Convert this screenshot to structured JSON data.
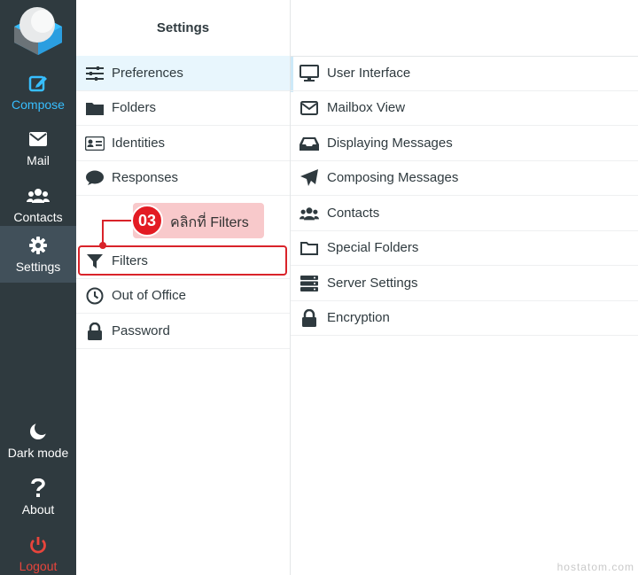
{
  "nav": {
    "compose": "Compose",
    "mail": "Mail",
    "contacts": "Contacts",
    "settings": "Settings",
    "dark_mode": "Dark mode",
    "about": "About",
    "logout": "Logout"
  },
  "settings": {
    "title": "Settings",
    "items": {
      "preferences": "Preferences",
      "folders": "Folders",
      "identities": "Identities",
      "responses": "Responses",
      "filters": "Filters",
      "out_of_office": "Out of Office",
      "password": "Password"
    }
  },
  "preferences": {
    "user_interface": "User Interface",
    "mailbox_view": "Mailbox View",
    "displaying_messages": "Displaying Messages",
    "composing_messages": "Composing Messages",
    "contacts": "Contacts",
    "special_folders": "Special Folders",
    "server_settings": "Server Settings",
    "encryption": "Encryption"
  },
  "annotation": {
    "step": "03",
    "text": "คลิกที่ Filters"
  },
  "watermark": "hostatom.com",
  "colors": {
    "nav_bg": "#2f3a3f",
    "accent": "#37beff",
    "logout": "#e8453c",
    "highlight": "#d9232a"
  }
}
